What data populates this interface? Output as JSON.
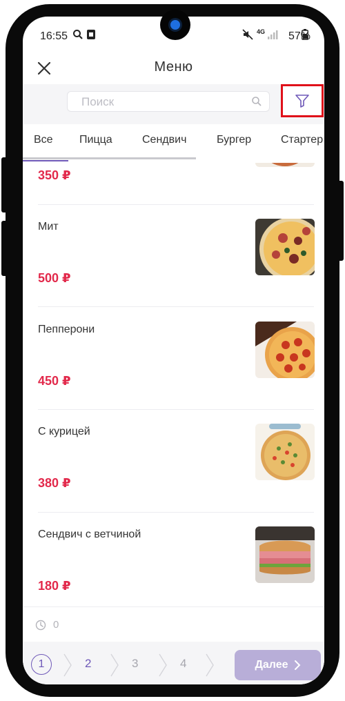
{
  "status_bar": {
    "time": "16:55",
    "battery": "57%",
    "network": "4G"
  },
  "header": {
    "title": "Меню"
  },
  "search": {
    "placeholder": "Поиск"
  },
  "tabs": [
    {
      "label": "Все"
    },
    {
      "label": "Пицца"
    },
    {
      "label": "Сендвич"
    },
    {
      "label": "Бургер"
    },
    {
      "label": "Стартер"
    }
  ],
  "menu": {
    "first_price": "350 ₽",
    "items": [
      {
        "name": "Мит",
        "price": "500 ₽"
      },
      {
        "name": "Пепперони",
        "price": "450 ₽"
      },
      {
        "name": "С курицей",
        "price": "380 ₽"
      },
      {
        "name": "Сендвич с ветчиной",
        "price": "180 ₽"
      }
    ]
  },
  "footer": {
    "timer_value": "0",
    "steps": [
      "1",
      "2",
      "3",
      "4"
    ],
    "next_label": "Далее"
  },
  "colors": {
    "accent": "#6e58b8",
    "price": "#e2294b",
    "highlight": "#e0101a",
    "next_button": "#b8aed8"
  }
}
